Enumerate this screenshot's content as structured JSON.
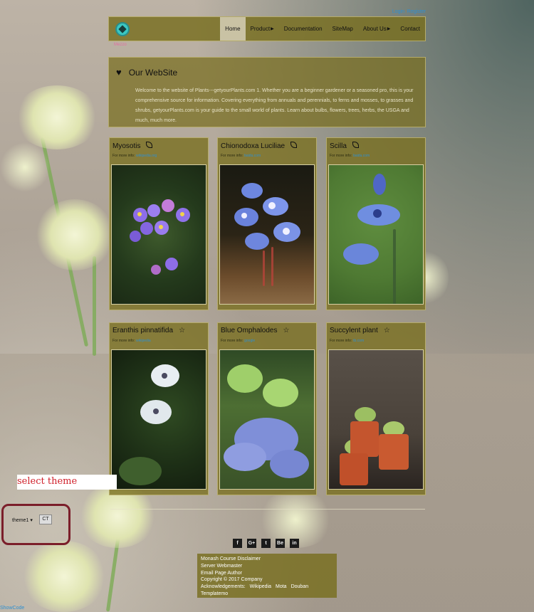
{
  "top_links": {
    "login": "Login",
    "register": "Register"
  },
  "nav": {
    "items": [
      {
        "label": "Home",
        "active": true,
        "caret": false
      },
      {
        "label": "Product",
        "active": false,
        "caret": true
      },
      {
        "label": "Documentation",
        "active": false,
        "caret": false
      },
      {
        "label": "SiteMap",
        "active": false,
        "caret": false
      },
      {
        "label": "About Us",
        "active": false,
        "caret": true
      },
      {
        "label": "Contact",
        "active": false,
        "caret": false
      }
    ]
  },
  "pink_note": "Mezzo",
  "intro": {
    "title": "Our WebSite",
    "text": "Welcome to the website of Plants---getyourPlants.com 1. Whether you are a beginner gardener or a seasoned pro, this is your comprehensive source for information. Covering everything from annuals and perennials, to ferns and mosses, to grasses and shrubs, getyourPlants.com is your guide to the small world of plants. Learn about bulbs, flowers, trees, herbs, the USGA and much, much more."
  },
  "cards": [
    {
      "title": "Myosotis",
      "icon": "leaf-icon",
      "info_label": "For more info:",
      "info_link": "wikipedia.org"
    },
    {
      "title": "Chionodoxa Luciliae",
      "icon": "leaf-icon",
      "info_label": "For more info:",
      "info_link": "baidu.com"
    },
    {
      "title": "Scilla",
      "icon": "leaf-icon",
      "info_label": "For more info:",
      "info_link": "baidu.com"
    },
    {
      "title": "Eranthis pinnatifida",
      "icon": "star-icon",
      "info_label": "For more info:",
      "info_link": "wikipedia"
    },
    {
      "title": "Blue Omphalodes",
      "icon": "star-icon",
      "info_label": "For more info:",
      "info_link": "google"
    },
    {
      "title": "Succylent plant",
      "icon": "star-icon",
      "info_label": "For more info:",
      "info_link": "tb.com"
    }
  ],
  "theme": {
    "label": "select theme",
    "selected": "theme1",
    "button": "CT"
  },
  "social": [
    "f",
    "G+",
    "t",
    "Be",
    "in"
  ],
  "footer": {
    "line1": "Monash Course Disclaimer",
    "line2": "Server Webmaster",
    "line3": "Email Page Author",
    "line4": "Copyright © 2017 Company",
    "ack_label": "Acknowledgements:",
    "ack_links": [
      "Wikipedia",
      "Mota",
      "Douban"
    ],
    "line6": "Templatemo"
  },
  "show_code": "ShowCode"
}
